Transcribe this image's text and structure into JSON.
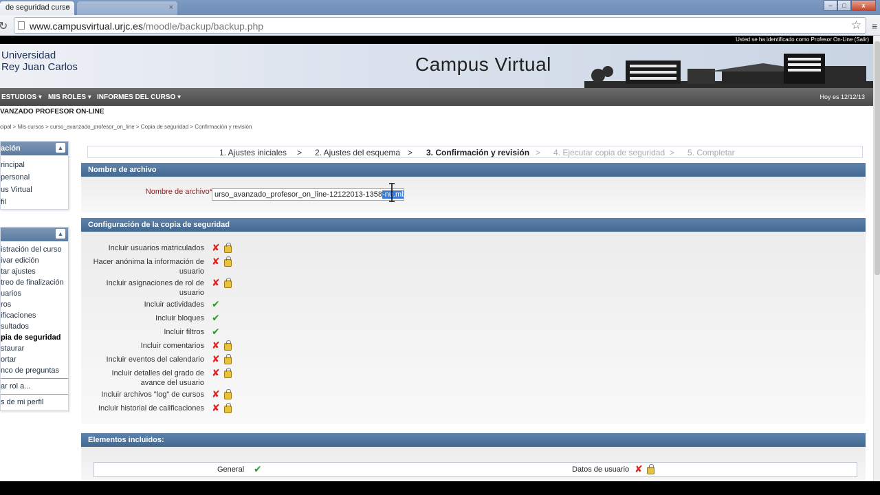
{
  "browser": {
    "tabs": [
      {
        "title": "de seguridad curso"
      },
      {
        "title": ""
      }
    ],
    "url_host": "www.campusvirtual.urjc.es",
    "url_path": "/moodle/backup/backup.php",
    "window_buttons": {
      "minimize": "–",
      "maximize": "□",
      "close": "x"
    }
  },
  "header": {
    "user_info": "Usted se ha identificado como Profesor On-Line (Salir)",
    "university_line1": "Universidad",
    "university_line2": "Rey Juan Carlos",
    "campus_title": "Campus Virtual"
  },
  "nav": {
    "items": [
      "ESTUDIOS ▾",
      "MIS ROLES ▾",
      "INFORMES DEL CURSO ▾"
    ],
    "date": "Hoy es 12/12/13"
  },
  "course": {
    "title": "VANZADO PROFESOR ON-LINE",
    "breadcrumb": "cipal  > Mis cursos >  curso_avanzado_profesor_on_line  >  Copia de seguridad  > Confirmación y revisión"
  },
  "sidebar": {
    "block1": {
      "title": "ación",
      "items": [
        "rincipal",
        "personal",
        "us Virtual",
        "fil"
      ]
    },
    "block2": {
      "title": "",
      "items": [
        {
          "label": "istración del curso",
          "bold": false
        },
        {
          "label": "ivar edición",
          "bold": false
        },
        {
          "label": "tar ajustes",
          "bold": false
        },
        {
          "label": "treo de finalización",
          "bold": false
        },
        {
          "label": "uarios",
          "bold": false
        },
        {
          "label": "ros",
          "bold": false
        },
        {
          "label": "ificaciones",
          "bold": false
        },
        {
          "label": "sultados",
          "bold": false
        },
        {
          "label": "pia de seguridad",
          "bold": true
        },
        {
          "label": "staurar",
          "bold": false
        },
        {
          "label": "ortar",
          "bold": false
        },
        {
          "label": "nco de preguntas",
          "bold": false
        }
      ],
      "extra1": "ar rol a...",
      "extra2": "s de mi perfil"
    }
  },
  "steps": [
    {
      "label": "1. Ajustes iniciales",
      "state": "done"
    },
    {
      "label": ">",
      "state": "done"
    },
    {
      "label": "2. Ajustes del esquema",
      "state": "done"
    },
    {
      "label": ">",
      "state": "done"
    },
    {
      "label": "3. Confirmación y revisión",
      "state": "current"
    },
    {
      "label": ">",
      "state": "future"
    },
    {
      "label": "4. Ejecutar copia de seguridad",
      "state": "future"
    },
    {
      "label": ">",
      "state": "future"
    },
    {
      "label": "5. Completar",
      "state": "future"
    }
  ],
  "filename_section": {
    "title": "Nombre de archivo",
    "label": "Nombre de archivo",
    "required_mark": "*",
    "value_prefix": "urso_avanzado_profesor_on_line-12122013-1358",
    "value_selected": "-nu.mbz"
  },
  "config_section": {
    "title": "Configuración de la copia de seguridad",
    "options": [
      {
        "label": "Incluir usuarios matriculados",
        "lines": 1,
        "checked": false,
        "locked": true
      },
      {
        "label": "Hacer anónima la información de usuario",
        "lines": 2,
        "checked": false,
        "locked": true
      },
      {
        "label": "Incluir asignaciones de rol de usuario",
        "lines": 2,
        "checked": false,
        "locked": true
      },
      {
        "label": "Incluir actividades",
        "lines": 1,
        "checked": true,
        "locked": false
      },
      {
        "label": "Incluir bloques",
        "lines": 1,
        "checked": true,
        "locked": false
      },
      {
        "label": "Incluir filtros",
        "lines": 1,
        "checked": true,
        "locked": false
      },
      {
        "label": "Incluir comentarios",
        "lines": 1,
        "checked": false,
        "locked": true
      },
      {
        "label": "Incluir eventos del calendario",
        "lines": 1,
        "checked": false,
        "locked": true
      },
      {
        "label": "Incluir detalles del grado de avance del usuario",
        "lines": 2,
        "checked": false,
        "locked": true
      },
      {
        "label": "Incluir archivos \"log\" de cursos",
        "lines": 1,
        "checked": false,
        "locked": true
      },
      {
        "label": "Incluir historial de calificaciones",
        "lines": 1,
        "checked": false,
        "locked": true
      }
    ]
  },
  "included_section": {
    "title": "Elementos incluidos:",
    "general_label": "General",
    "user_data_label": "Datos de usuario"
  },
  "marks": {
    "x": "✘",
    "ok": "✔"
  },
  "colors": {
    "accent": "#4f7299",
    "x": "#d22222",
    "ok": "#2a9a2a"
  }
}
